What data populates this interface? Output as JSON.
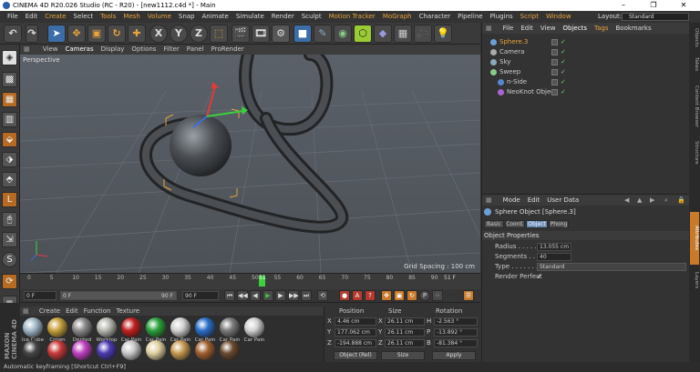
{
  "window": {
    "title": "CINEMA 4D R20.026 Studio (RC - R20) - [new1112.c4d *] - Main",
    "min": "–",
    "max": "❐",
    "close": "✕"
  },
  "menu": [
    "File",
    "Edit",
    "Create",
    "Select",
    "Tools",
    "Mesh",
    "Volume",
    "Snap",
    "Animate",
    "Simulate",
    "Render",
    "Sculpt",
    "Motion Tracker",
    "MoGraph",
    "Character",
    "Pipeline",
    "Plugins",
    "Script",
    "Window"
  ],
  "menu_highlight": [
    "Create",
    "Tools",
    "Mesh",
    "Volume",
    "Motion Tracker",
    "MoGraph",
    "Script",
    "Window"
  ],
  "layout": {
    "label": "Layout:",
    "value": "Standard"
  },
  "toolbar_icons": [
    "undo-icon",
    "redo-icon",
    "select-icon",
    "move-icon",
    "scale-icon",
    "rotate-icon",
    "x-axis-icon",
    "y-axis-icon",
    "z-axis-icon",
    "coordinate-system-icon",
    "render-view-icon",
    "render-picture-viewer-icon",
    "render-settings-icon",
    "cube-icon",
    "pen-icon",
    "subdivision-icon",
    "array-icon",
    "deformer-icon",
    "floor-icon",
    "camera-icon",
    "light-icon"
  ],
  "toolbar_labels": {
    "x": "X",
    "y": "Y",
    "z": "Z"
  },
  "viewport": {
    "menu": [
      "View",
      "Cameras",
      "Display",
      "Options",
      "Filter",
      "Panel",
      "ProRender"
    ],
    "label": "Perspective",
    "grid_spacing": "Grid Spacing : 100 cm"
  },
  "timeline": {
    "ticks": [
      "0",
      "5",
      "10",
      "15",
      "20",
      "25",
      "30",
      "35",
      "40",
      "45",
      "50",
      "55",
      "60",
      "65",
      "70",
      "75",
      "80",
      "85",
      "90"
    ],
    "current_frame": "51",
    "frame_field": "51 F"
  },
  "playback": {
    "start": "0 F",
    "current": "0 F",
    "end": "90 F",
    "end2": "90 F"
  },
  "materials": {
    "menu": [
      "Create",
      "Edit",
      "Function",
      "Texture"
    ],
    "row1": [
      {
        "name": "Ice Cube",
        "color": "#9fb7c6"
      },
      {
        "name": "Crown",
        "color": "#c7a03a"
      },
      {
        "name": "Dented",
        "color": "#8a8a8a"
      },
      {
        "name": "Worktop",
        "color": "#b7b7b0"
      },
      {
        "name": "Car Pain",
        "color": "#c02020"
      },
      {
        "name": "Car Pain",
        "color": "#2aa03a"
      },
      {
        "name": "Car Pain",
        "color": "#d0d0d0"
      },
      {
        "name": "Car Pain",
        "color": "#2a6ec8"
      },
      {
        "name": "Car Pain",
        "color": "#7a7a7a"
      },
      {
        "name": "Car Pain",
        "color": "#d0d0d0"
      }
    ],
    "row2": [
      {
        "color": "#444444"
      },
      {
        "color": "#c83a3a"
      },
      {
        "color": "#c040c0"
      },
      {
        "color": "#4a3ab0"
      },
      {
        "color": "#c8c8c8"
      },
      {
        "color": "#e0d0a0"
      },
      {
        "color": "#c89a50"
      },
      {
        "color": "#a06030"
      },
      {
        "color": "#6a4a30"
      }
    ]
  },
  "coords": {
    "headers": [
      "Position",
      "Size",
      "Rotation"
    ],
    "rows": [
      {
        "axis": "X",
        "pos": "4.46 cm",
        "size": "26.11 cm",
        "rot_axis": "H",
        "rot": "-2.563 °"
      },
      {
        "axis": "Y",
        "pos": "177.062 cm",
        "size": "26.11 cm",
        "rot_axis": "P",
        "rot": "-13.892 °"
      },
      {
        "axis": "Z",
        "pos": "-194.888 cm",
        "size": "26.11 cm",
        "rot_axis": "B",
        "rot": "-81.384 °"
      }
    ],
    "mode1": "Object (Rel)",
    "mode2": "Size",
    "apply": "Apply"
  },
  "objects": {
    "menu": [
      "File",
      "Edit",
      "View",
      "Objects",
      "Tags",
      "Bookmarks"
    ],
    "items": [
      {
        "name": "Sphere.3",
        "indent": 0,
        "selected": true
      },
      {
        "name": "Camera",
        "indent": 0,
        "selected": false
      },
      {
        "name": "Sky",
        "indent": 0,
        "selected": false
      },
      {
        "name": "Sweep",
        "indent": 0,
        "selected": false
      },
      {
        "name": "n-Side",
        "indent": 1,
        "selected": false
      },
      {
        "name": "NeoKnot Object",
        "indent": 1,
        "selected": false
      }
    ]
  },
  "attributes": {
    "menu": [
      "Mode",
      "Edit",
      "User Data"
    ],
    "title": "Sphere Object [Sphere.3]",
    "tabs": [
      "Basic",
      "Coord.",
      "Object",
      "Phong"
    ],
    "active_tab": "Object",
    "section": "Object Properties",
    "props": [
      {
        "label": "Radius . . . . . . .",
        "value": "13.055 cm"
      },
      {
        "label": "Segments . . . .",
        "value": "40"
      },
      {
        "label": "Type . . . . . . . .",
        "value": "Standard"
      },
      {
        "label": "Render Perfect",
        "value": "✓"
      }
    ]
  },
  "right_tabs": [
    "Objects",
    "Takes",
    "Content Browser",
    "Structure",
    "Attributes",
    "Layers"
  ],
  "status": "Automatic keyframing [Shortcut Ctrl+F9]",
  "colors": {
    "accent": "#e8a33c",
    "selected_blue": "#3b6ea8",
    "viewport_bg": "#565d65"
  }
}
